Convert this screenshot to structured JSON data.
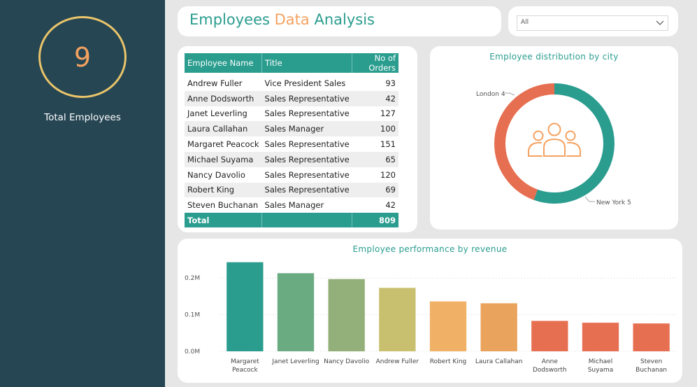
{
  "kpi": {
    "value": "9",
    "label": "Total Employees"
  },
  "header": {
    "title_part1": "Employees ",
    "title_part2": "Data",
    "title_part3": " Analysis"
  },
  "filter": {
    "value": "All"
  },
  "table": {
    "columns": [
      "Employee Name",
      "Title",
      "No of Orders"
    ],
    "rows": [
      [
        "Andrew Fuller",
        "Vice President Sales",
        "93"
      ],
      [
        "Anne Dodsworth",
        "Sales Representative",
        "42"
      ],
      [
        "Janet Leverling",
        "Sales Representative",
        "127"
      ],
      [
        "Laura Callahan",
        "Sales Manager",
        "100"
      ],
      [
        "Margaret Peacock",
        "Sales Representative",
        "151"
      ],
      [
        "Michael Suyama",
        "Sales Representative",
        "65"
      ],
      [
        "Nancy Davolio",
        "Sales Representative",
        "120"
      ],
      [
        "Robert King",
        "Sales Representative",
        "69"
      ],
      [
        "Steven Buchanan",
        "Sales Manager",
        "42"
      ]
    ],
    "total_label": "Total",
    "total_value": "809"
  },
  "donut": {
    "title": "Employee distribution by city",
    "icon": "people-group-icon",
    "slices": [
      {
        "label": "London 4",
        "value": 4,
        "color": "#e76f51"
      },
      {
        "label": "New York 5",
        "value": 5,
        "color": "#2a9d8f"
      }
    ]
  },
  "chart_data": {
    "type": "bar",
    "title": "Employee performance by revenue",
    "categories": [
      [
        "Margaret",
        "Peacock"
      ],
      [
        "Janet Leverling"
      ],
      [
        "Nancy Davolio"
      ],
      [
        "Andrew Fuller"
      ],
      [
        "Robert King"
      ],
      [
        "Laura Callahan"
      ],
      [
        "Anne",
        "Dodsworth"
      ],
      [
        "Michael",
        "Suyama"
      ],
      [
        "Steven",
        "Buchanan"
      ]
    ],
    "values": [
      243000,
      213000,
      197000,
      173000,
      136000,
      131000,
      83000,
      78000,
      76000
    ],
    "colors": [
      "#2a9d8f",
      "#6aab82",
      "#93b07a",
      "#c9c06f",
      "#f0b167",
      "#eaa35c",
      "#e76f51",
      "#e76f51",
      "#e76f51"
    ],
    "ylim": [
      0,
      250000
    ],
    "yticks": [
      {
        "value": 0,
        "label": "0.0M"
      },
      {
        "value": 100000,
        "label": "0.1M"
      },
      {
        "value": 200000,
        "label": "0.2M"
      }
    ],
    "grid": true,
    "xlabel": "",
    "ylabel": ""
  }
}
